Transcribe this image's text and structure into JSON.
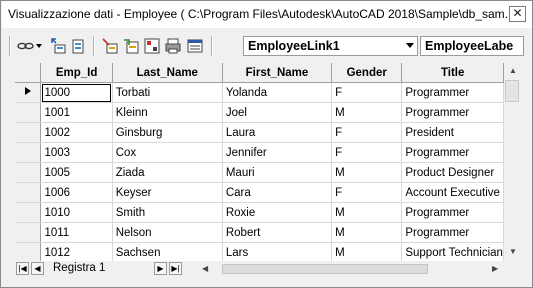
{
  "window": {
    "title": "Visualizzazione dati - Employee ( C:\\Program Files\\Autodesk\\AutoCAD 2018\\Sample\\db_sam..."
  },
  "toolbar": {
    "link_combo": "EmployeeLink1",
    "label_combo": "EmployeeLabe"
  },
  "grid": {
    "columns": [
      "Emp_Id",
      "Last_Name",
      "First_Name",
      "Gender",
      "Title"
    ],
    "rows": [
      [
        "1000",
        "Torbati",
        "Yolanda",
        "F",
        "Programmer"
      ],
      [
        "1001",
        "Kleinn",
        "Joel",
        "M",
        "Programmer"
      ],
      [
        "1002",
        "Ginsburg",
        "Laura",
        "F",
        "President"
      ],
      [
        "1003",
        "Cox",
        "Jennifer",
        "F",
        "Programmer"
      ],
      [
        "1005",
        "Ziada",
        "Mauri",
        "M",
        "Product Designer"
      ],
      [
        "1006",
        "Keyser",
        "Cara",
        "F",
        "Account Executive"
      ],
      [
        "1010",
        "Smith",
        "Roxie",
        "M",
        "Programmer"
      ],
      [
        "1011",
        "Nelson",
        "Robert",
        "M",
        "Programmer"
      ],
      [
        "1012",
        "Sachsen",
        "Lars",
        "M",
        "Support Technician"
      ]
    ]
  },
  "status": {
    "record_label": "Registra",
    "record_number": "1"
  }
}
